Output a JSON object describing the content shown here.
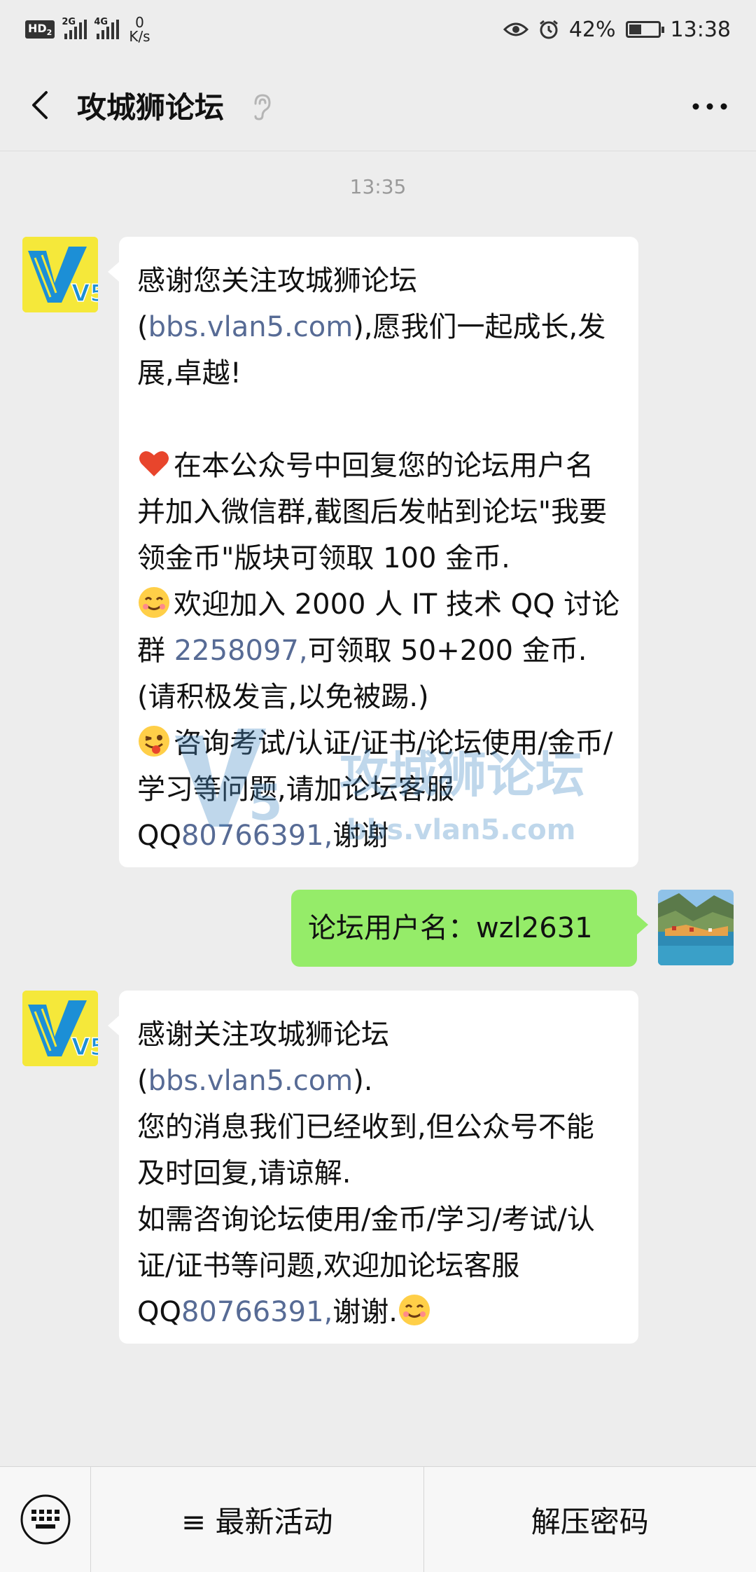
{
  "status_bar": {
    "network_hd": "HD",
    "network_sub": "2",
    "sig1_label": "2G",
    "sig2_label": "4G",
    "speed_value": "0",
    "speed_unit": "K/s",
    "battery": "42%",
    "battery_level": 0.42,
    "time": "13:38"
  },
  "header": {
    "title": "攻城狮论坛"
  },
  "chat": {
    "timestamp": "13:35",
    "msg1": {
      "l1a": "感谢您关注攻城狮论坛(",
      "l1link": "bbs.vlan5.",
      "l2link": "com",
      "l2b": "),愿我们一起成长,发展,卓越!",
      "p2": "在本公众号中回复您的论坛用户名并加入微信群,截图后发帖到论坛\"我要领金币\"版块可领取 100 金币.",
      "p3a": "欢迎加入 2000 人 IT 技术 QQ 讨论群 ",
      "p3link": "2258097,",
      "p3b": "可领取 50+200 金币.",
      "p3c": "(请积极发言,以免被踢.)",
      "p4a": "咨询考试/认证/证书/论坛使用/金币/学习等问题,请加论坛客服 QQ",
      "p4link": "80766391,",
      "p4b": "谢谢"
    },
    "msg2": {
      "text": "论坛用户名：wzl2631"
    },
    "msg3": {
      "l1a": "感谢关注攻城狮论坛(",
      "l1link": "bbs.vlan5.",
      "l2link": "com",
      "l2b": ").",
      "p2": "您的消息我们已经收到,但公众号不能及时回复,请谅解.",
      "p3a": "如需咨询论坛使用/金币/学习/考试/认证/证书等问题,欢迎加论坛客服 QQ",
      "p3link": "80766391,",
      "p3b": "谢谢."
    },
    "watermark_text": "攻城狮论坛",
    "watermark_url": "bbs.vlan5.com",
    "avatar_text": "V5"
  },
  "bottom_menu": {
    "item1": "≡ 最新活动",
    "item2": "解压密码"
  },
  "colors": {
    "bubble_right": "#95ec69",
    "link": "#576b95",
    "background": "#ededed"
  }
}
